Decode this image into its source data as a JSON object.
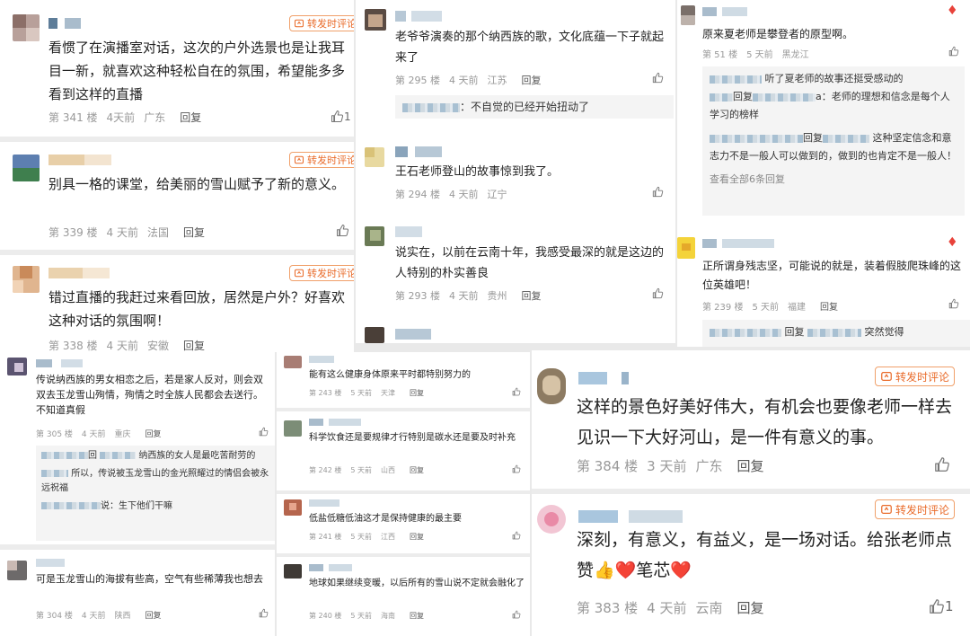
{
  "ui": {
    "reply": "回复",
    "forward": "转发时评论",
    "view_all": "查看全部6条回复"
  },
  "colors": {
    "accent": "#e96b2a",
    "heart": "#e8423a",
    "blur": "#9bb7cc"
  },
  "icons": [
    "thumb-up-icon",
    "forward-icon",
    "heart-icon"
  ],
  "p1": [
    {
      "text": "看惯了在演播室对话，这次的户外选景也是让我耳目一新，就喜欢这种轻松自在的氛围，希望能多多看到这样的直播",
      "floor": "第 341 楼",
      "time": "4天前",
      "loc": "广东",
      "likes": "1"
    },
    {
      "text": "别具一格的课堂，给美丽的雪山赋予了新的意义。",
      "floor": "第 339 楼",
      "time": "4 天前",
      "loc": "法国",
      "likes": ""
    },
    {
      "text": "错过直播的我赶过来看回放，居然是户外？好喜欢这种对话的氛围啊！",
      "floor": "第 338 楼",
      "time": "4 天前",
      "loc": "安徽",
      "likes": ""
    }
  ],
  "p2": [
    {
      "text": "老爷爷演奏的那个纳西族的歌，文化底蕴一下子就起来了",
      "floor": "第 295 楼",
      "time": "4 天前",
      "loc": "江苏",
      "reply": "：不自觉的已经开始扭动了"
    },
    {
      "text": "王石老师登山的故事惊到我了。",
      "floor": "第 294 楼",
      "time": "4 天前",
      "loc": "辽宁"
    },
    {
      "text": "说实在，以前在云南十年，我感受最深的就是这边的人特别的朴实善良",
      "floor": "第 293 楼",
      "time": "4 天前",
      "loc": "贵州"
    }
  ],
  "p3": [
    {
      "text": "原来夏老师是攀登者的原型啊。",
      "floor": "第 51 楼",
      "time": "5 天前",
      "loc": "黑龙江",
      "r1a": "听了夏老师的故事还挺受感动的",
      "r1b": "回复",
      "r1c": "a：老师的理想和信念是每个人学习的榜样",
      "r2a": "回复",
      "r2b": "这种坚定信念和意志力不是一般人可以做到的，做到的也肯定不是一般人！"
    },
    {
      "text": "正所谓身残志坚，可能说的就是，装着假肢爬珠峰的这位英雄吧！",
      "floor": "第 239 楼",
      "time": "5 天前",
      "loc": "福建",
      "r1a": "回复",
      "r1b": "突然觉得"
    }
  ],
  "p4": [
    {
      "text": "传说纳西族的男女相恋之后，若是家人反对，则会双双去玉龙雪山殉情，殉情之时全族人民都会去送行。不知道真假",
      "floor": "第 305 楼",
      "time": "4 天前",
      "loc": "重庆",
      "r1a": "回",
      "r1b": "纳西族的女人是最吃苦耐劳的",
      "r2": "所以，传说被玉龙雪山的金光照耀过的情侣会被永远祝福",
      "r3": "说：生下他们干嘛"
    },
    {
      "text": "可是玉龙雪山的海拔有些高，空气有些稀薄我也想去",
      "floor": "第 304 楼",
      "time": "4 天前",
      "loc": "陕西"
    }
  ],
  "p5": [
    {
      "text": "能有这么健康身体原来平时都特别努力的",
      "floor": "第 243 楼",
      "time": "5 天前",
      "loc": "天津"
    },
    {
      "text": "科学饮食还是要规律才行特别是碳水还是要及时补充",
      "floor": "第 242 楼",
      "time": "5 天前",
      "loc": "山西"
    },
    {
      "text": "低盐低糖低油这才是保持健康的最主要",
      "floor": "第 241 楼",
      "time": "5 天前",
      "loc": "江西"
    },
    {
      "text": "地球如果继续变暖，以后所有的雪山说不定就会融化了",
      "floor": "第 240 楼",
      "time": "5 天前",
      "loc": "海南"
    }
  ],
  "p6": [
    {
      "text": "这样的景色好美好伟大，有机会也要像老师一样去见识一下大好河山，是一件有意义的事。",
      "floor": "第 384 楼",
      "time": "3 天前",
      "loc": "广东",
      "likes": ""
    },
    {
      "text_a": "深刻，有意义，有益义，是一场对话。给张老师点赞",
      "emoji": "👍❤️",
      "text_b": "笔芯",
      "emoji2": "❤️",
      "floor": "第 383 楼",
      "time": "4 天前",
      "loc": "云南",
      "likes": "1"
    }
  ]
}
